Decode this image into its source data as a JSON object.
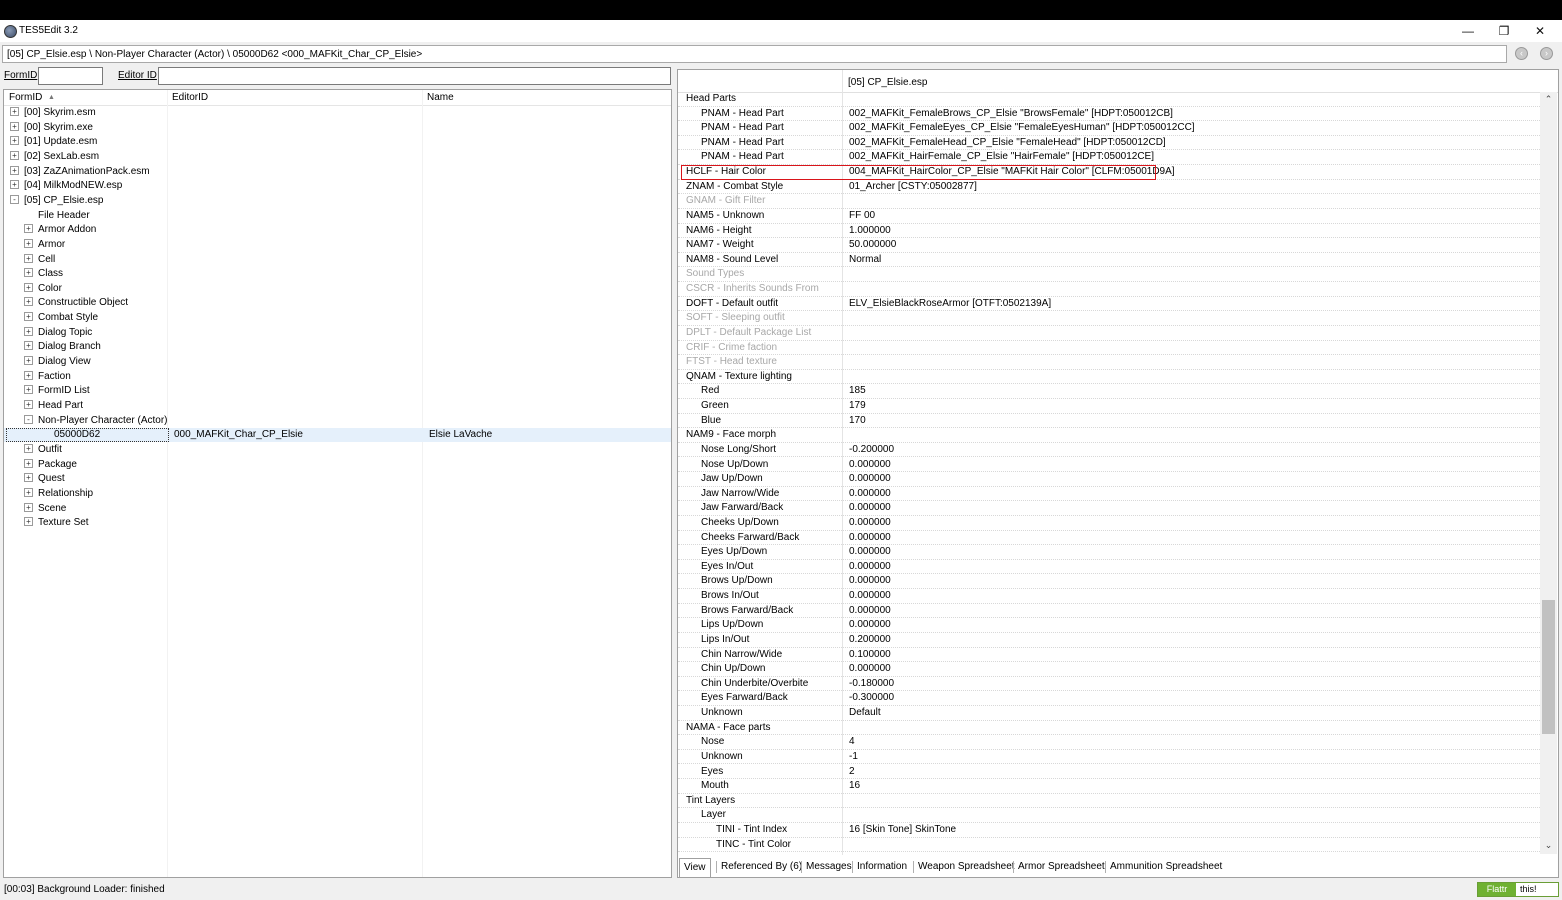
{
  "window": {
    "title": "TES5Edit 3.2",
    "minimize": "—",
    "restore": "❐",
    "close": "✕"
  },
  "path": "[05] CP_Elsie.esp \\ Non-Player Character (Actor) \\ 05000D62 <000_MAFKit_Char_CP_Elsie>",
  "nav": {
    "back_icon": "back-icon",
    "forward_icon": "forward-icon"
  },
  "filter": {
    "formid_label": "FormID",
    "formid_value": "",
    "editorid_label": "Editor ID",
    "editorid_value": ""
  },
  "tree": {
    "columns": [
      "FormID",
      "EditorID",
      "Name"
    ],
    "sort_arrow": "▲",
    "rows": [
      {
        "depth": 0,
        "exp": "+",
        "formid": "[00] Skyrim.esm",
        "editorid": "",
        "name": ""
      },
      {
        "depth": 0,
        "exp": "+",
        "formid": "[00] Skyrim.exe",
        "editorid": "",
        "name": ""
      },
      {
        "depth": 0,
        "exp": "+",
        "formid": "[01] Update.esm",
        "editorid": "",
        "name": ""
      },
      {
        "depth": 0,
        "exp": "+",
        "formid": "[02] SexLab.esm",
        "editorid": "",
        "name": ""
      },
      {
        "depth": 0,
        "exp": "+",
        "formid": "[03] ZaZAnimationPack.esm",
        "editorid": "",
        "name": ""
      },
      {
        "depth": 0,
        "exp": "+",
        "formid": "[04] MilkModNEW.esp",
        "editorid": "",
        "name": ""
      },
      {
        "depth": 0,
        "exp": "-",
        "formid": "[05] CP_Elsie.esp",
        "editorid": "",
        "name": ""
      },
      {
        "depth": 1,
        "exp": "",
        "formid": "File Header",
        "editorid": "",
        "name": ""
      },
      {
        "depth": 1,
        "exp": "+",
        "formid": "Armor Addon",
        "editorid": "",
        "name": ""
      },
      {
        "depth": 1,
        "exp": "+",
        "formid": "Armor",
        "editorid": "",
        "name": ""
      },
      {
        "depth": 1,
        "exp": "+",
        "formid": "Cell",
        "editorid": "",
        "name": ""
      },
      {
        "depth": 1,
        "exp": "+",
        "formid": "Class",
        "editorid": "",
        "name": ""
      },
      {
        "depth": 1,
        "exp": "+",
        "formid": "Color",
        "editorid": "",
        "name": ""
      },
      {
        "depth": 1,
        "exp": "+",
        "formid": "Constructible Object",
        "editorid": "",
        "name": ""
      },
      {
        "depth": 1,
        "exp": "+",
        "formid": "Combat Style",
        "editorid": "",
        "name": ""
      },
      {
        "depth": 1,
        "exp": "+",
        "formid": "Dialog Topic",
        "editorid": "",
        "name": ""
      },
      {
        "depth": 1,
        "exp": "+",
        "formid": "Dialog Branch",
        "editorid": "",
        "name": ""
      },
      {
        "depth": 1,
        "exp": "+",
        "formid": "Dialog View",
        "editorid": "",
        "name": ""
      },
      {
        "depth": 1,
        "exp": "+",
        "formid": "Faction",
        "editorid": "",
        "name": ""
      },
      {
        "depth": 1,
        "exp": "+",
        "formid": "FormID List",
        "editorid": "",
        "name": ""
      },
      {
        "depth": 1,
        "exp": "+",
        "formid": "Head Part",
        "editorid": "",
        "name": ""
      },
      {
        "depth": 1,
        "exp": "-",
        "formid": "Non-Player Character (Actor)",
        "editorid": "",
        "name": ""
      },
      {
        "depth": 2,
        "exp": "",
        "formid": "05000D62",
        "editorid": "000_MAFKit_Char_CP_Elsie",
        "name": "Elsie LaVache",
        "selected": true
      },
      {
        "depth": 1,
        "exp": "+",
        "formid": "Outfit",
        "editorid": "",
        "name": ""
      },
      {
        "depth": 1,
        "exp": "+",
        "formid": "Package",
        "editorid": "",
        "name": ""
      },
      {
        "depth": 1,
        "exp": "+",
        "formid": "Quest",
        "editorid": "",
        "name": ""
      },
      {
        "depth": 1,
        "exp": "+",
        "formid": "Relationship",
        "editorid": "",
        "name": ""
      },
      {
        "depth": 1,
        "exp": "+",
        "formid": "Scene",
        "editorid": "",
        "name": ""
      },
      {
        "depth": 1,
        "exp": "+",
        "formid": "Texture Set",
        "editorid": "",
        "name": ""
      }
    ]
  },
  "record": {
    "header": "[05] CP_Elsie.esp",
    "rows": [
      {
        "l": "Head Parts",
        "v": "",
        "d": 0
      },
      {
        "l": "PNAM - Head Part",
        "v": "002_MAFKit_FemaleBrows_CP_Elsie \"BrowsFemale\" [HDPT:050012CB]",
        "d": 1
      },
      {
        "l": "PNAM - Head Part",
        "v": "002_MAFKit_FemaleEyes_CP_Elsie \"FemaleEyesHuman\" [HDPT:050012CC]",
        "d": 1
      },
      {
        "l": "PNAM - Head Part",
        "v": "002_MAFKit_FemaleHead_CP_Elsie \"FemaleHead\" [HDPT:050012CD]",
        "d": 1
      },
      {
        "l": "PNAM - Head Part",
        "v": "002_MAFKit_HairFemale_CP_Elsie \"HairFemale\" [HDPT:050012CE]",
        "d": 1
      },
      {
        "l": "HCLF - Hair Color",
        "v": "004_MAFKit_HairColor_CP_Elsie \"MAFKit Hair Color\" [CLFM:05001D9A]",
        "d": 0
      },
      {
        "l": "ZNAM - Combat Style",
        "v": "01_Archer [CSTY:05002877]",
        "d": 0
      },
      {
        "l": "GNAM - Gift Filter",
        "v": "",
        "d": 0,
        "dim": true
      },
      {
        "l": "NAM5 - Unknown",
        "v": "FF 00",
        "d": 0
      },
      {
        "l": "NAM6 - Height",
        "v": "1.000000",
        "d": 0
      },
      {
        "l": "NAM7 - Weight",
        "v": "50.000000",
        "d": 0
      },
      {
        "l": "NAM8 - Sound Level",
        "v": "Normal",
        "d": 0
      },
      {
        "l": "Sound Types",
        "v": "",
        "d": 0,
        "dim": true
      },
      {
        "l": "CSCR - Inherits Sounds From",
        "v": "",
        "d": 0,
        "dim": true
      },
      {
        "l": "DOFT - Default outfit",
        "v": "ELV_ElsieBlackRoseArmor [OTFT:0502139A]",
        "d": 0
      },
      {
        "l": "SOFT - Sleeping outfit",
        "v": "",
        "d": 0,
        "dim": true
      },
      {
        "l": "DPLT - Default Package List",
        "v": "",
        "d": 0,
        "dim": true
      },
      {
        "l": "CRIF - Crime faction",
        "v": "",
        "d": 0,
        "dim": true
      },
      {
        "l": "FTST - Head texture",
        "v": "",
        "d": 0,
        "dim": true
      },
      {
        "l": "QNAM - Texture lighting",
        "v": "",
        "d": 0
      },
      {
        "l": "Red",
        "v": "185",
        "d": 1
      },
      {
        "l": "Green",
        "v": "179",
        "d": 1
      },
      {
        "l": "Blue",
        "v": "170",
        "d": 1
      },
      {
        "l": "NAM9 - Face morph",
        "v": "",
        "d": 0
      },
      {
        "l": "Nose Long/Short",
        "v": "-0.200000",
        "d": 1
      },
      {
        "l": "Nose Up/Down",
        "v": "0.000000",
        "d": 1
      },
      {
        "l": "Jaw Up/Down",
        "v": "0.000000",
        "d": 1
      },
      {
        "l": "Jaw Narrow/Wide",
        "v": "0.000000",
        "d": 1
      },
      {
        "l": "Jaw Farward/Back",
        "v": "0.000000",
        "d": 1
      },
      {
        "l": "Cheeks Up/Down",
        "v": "0.000000",
        "d": 1
      },
      {
        "l": "Cheeks Farward/Back",
        "v": "0.000000",
        "d": 1
      },
      {
        "l": "Eyes Up/Down",
        "v": "0.000000",
        "d": 1
      },
      {
        "l": "Eyes In/Out",
        "v": "0.000000",
        "d": 1
      },
      {
        "l": "Brows Up/Down",
        "v": "0.000000",
        "d": 1
      },
      {
        "l": "Brows In/Out",
        "v": "0.000000",
        "d": 1
      },
      {
        "l": "Brows Farward/Back",
        "v": "0.000000",
        "d": 1
      },
      {
        "l": "Lips Up/Down",
        "v": "0.000000",
        "d": 1
      },
      {
        "l": "Lips In/Out",
        "v": "0.200000",
        "d": 1
      },
      {
        "l": "Chin Narrow/Wide",
        "v": "0.100000",
        "d": 1
      },
      {
        "l": "Chin Up/Down",
        "v": "0.000000",
        "d": 1
      },
      {
        "l": "Chin Underbite/Overbite",
        "v": "-0.180000",
        "d": 1
      },
      {
        "l": "Eyes Farward/Back",
        "v": "-0.300000",
        "d": 1
      },
      {
        "l": "Unknown",
        "v": "Default",
        "d": 1
      },
      {
        "l": "NAMA - Face parts",
        "v": "",
        "d": 0
      },
      {
        "l": "Nose",
        "v": "4",
        "d": 1
      },
      {
        "l": "Unknown",
        "v": "-1",
        "d": 1
      },
      {
        "l": "Eyes",
        "v": "2",
        "d": 1
      },
      {
        "l": "Mouth",
        "v": "16",
        "d": 1
      },
      {
        "l": "Tint Layers",
        "v": "",
        "d": 0
      },
      {
        "l": "Layer",
        "v": "",
        "d": 1
      },
      {
        "l": "TINI - Tint Index",
        "v": "16 [Skin Tone] SkinTone",
        "d": 2
      },
      {
        "l": "TINC - Tint Color",
        "v": "",
        "d": 2
      }
    ]
  },
  "tabs": [
    "View",
    "Referenced By (6)",
    "Messages",
    "Information",
    "Weapon Spreadsheet",
    "Armor Spreadsheet",
    "Ammunition Spreadsheet"
  ],
  "status": "[00:03] Background Loader: finished",
  "flattr": {
    "left": "Flattr",
    "right": "this!"
  },
  "colors": {
    "highlight": "#d9141a",
    "selection": "#e5f0fb",
    "flattr": "#6fb132"
  }
}
